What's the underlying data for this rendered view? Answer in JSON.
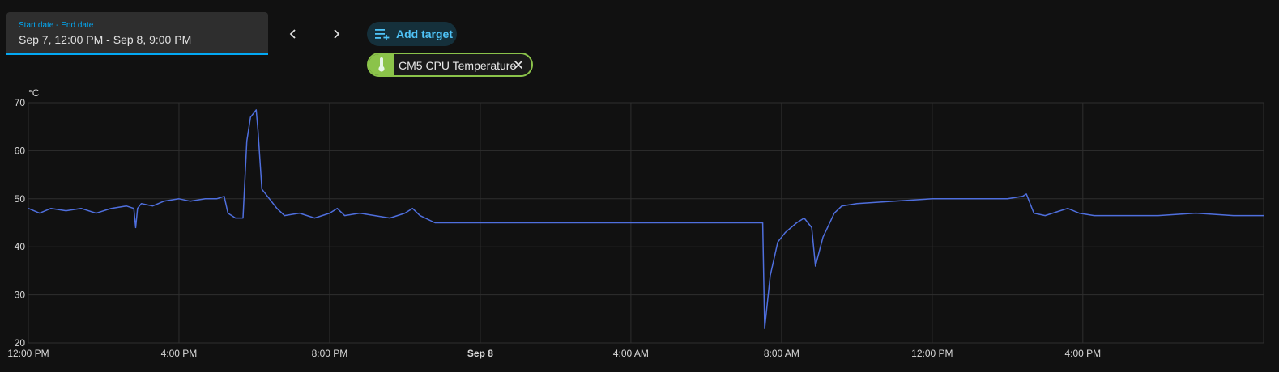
{
  "date_range": {
    "label": "Start date - End date",
    "value": "Sep 7, 12:00 PM - Sep 8, 9:00 PM"
  },
  "nav": {
    "prev_icon": "chevron-left-icon",
    "next_icon": "chevron-right-icon"
  },
  "add_target": {
    "label": "Add target",
    "icon": "playlist-plus-icon"
  },
  "targets": [
    {
      "label": "CM5 CPU Temperature",
      "icon": "thermometer-icon",
      "color": "#8bc34a"
    }
  ],
  "colors": {
    "accent": "#03a9f4",
    "series": "#4f6fde",
    "chip": "#8bc34a",
    "grid": "#2f2f2f",
    "background": "#111111"
  },
  "chart_data": {
    "type": "line",
    "ylabel": "°C",
    "xlabel": "",
    "ylim": [
      20,
      70
    ],
    "yticks": [
      20,
      30,
      40,
      50,
      60,
      70
    ],
    "grid": true,
    "xlim_hours": [
      0,
      32.8
    ],
    "xticks": [
      {
        "h": 0,
        "label": "12:00 PM",
        "bold": false
      },
      {
        "h": 4,
        "label": "4:00 PM",
        "bold": false
      },
      {
        "h": 8,
        "label": "8:00 PM",
        "bold": false
      },
      {
        "h": 12,
        "label": "Sep 8",
        "bold": true
      },
      {
        "h": 16,
        "label": "4:00 AM",
        "bold": false
      },
      {
        "h": 20,
        "label": "8:00 AM",
        "bold": false
      },
      {
        "h": 24,
        "label": "12:00 PM",
        "bold": false
      },
      {
        "h": 28,
        "label": "4:00 PM",
        "bold": false
      }
    ],
    "series": [
      {
        "name": "CM5 CPU Temperature",
        "points": [
          [
            0.0,
            48
          ],
          [
            0.3,
            47
          ],
          [
            0.6,
            48
          ],
          [
            1.0,
            47.5
          ],
          [
            1.4,
            48
          ],
          [
            1.8,
            47
          ],
          [
            2.2,
            48
          ],
          [
            2.6,
            48.5
          ],
          [
            2.8,
            48
          ],
          [
            2.85,
            44
          ],
          [
            2.9,
            48
          ],
          [
            3.0,
            49
          ],
          [
            3.3,
            48.5
          ],
          [
            3.6,
            49.5
          ],
          [
            4.0,
            50
          ],
          [
            4.3,
            49.5
          ],
          [
            4.7,
            50
          ],
          [
            5.0,
            50
          ],
          [
            5.2,
            50.5
          ],
          [
            5.3,
            47
          ],
          [
            5.5,
            46
          ],
          [
            5.7,
            46
          ],
          [
            5.8,
            62
          ],
          [
            5.9,
            67
          ],
          [
            6.0,
            68
          ],
          [
            6.05,
            68.5
          ],
          [
            6.1,
            64
          ],
          [
            6.2,
            52
          ],
          [
            6.4,
            50
          ],
          [
            6.6,
            48
          ],
          [
            6.8,
            46.5
          ],
          [
            7.2,
            47
          ],
          [
            7.6,
            46
          ],
          [
            8.0,
            47
          ],
          [
            8.2,
            48
          ],
          [
            8.4,
            46.5
          ],
          [
            8.8,
            47
          ],
          [
            9.2,
            46.5
          ],
          [
            9.6,
            46
          ],
          [
            10.0,
            47
          ],
          [
            10.2,
            48
          ],
          [
            10.4,
            46.5
          ],
          [
            10.8,
            45
          ],
          [
            15.0,
            45
          ],
          [
            18.0,
            45
          ],
          [
            19.5,
            45
          ],
          [
            19.55,
            23
          ],
          [
            19.7,
            34
          ],
          [
            19.9,
            41
          ],
          [
            20.1,
            43
          ],
          [
            20.4,
            45
          ],
          [
            20.6,
            46
          ],
          [
            20.8,
            44
          ],
          [
            20.9,
            36
          ],
          [
            21.1,
            42
          ],
          [
            21.4,
            47
          ],
          [
            21.6,
            48.5
          ],
          [
            22.0,
            49
          ],
          [
            23.0,
            49.5
          ],
          [
            24.0,
            50
          ],
          [
            25.0,
            50
          ],
          [
            26.0,
            50
          ],
          [
            26.4,
            50.5
          ],
          [
            26.5,
            51
          ],
          [
            26.7,
            47
          ],
          [
            27.0,
            46.5
          ],
          [
            27.4,
            47.5
          ],
          [
            27.6,
            48
          ],
          [
            27.9,
            47
          ],
          [
            28.3,
            46.5
          ],
          [
            29.0,
            46.5
          ],
          [
            30.0,
            46.5
          ],
          [
            31.0,
            47
          ],
          [
            32.0,
            46.5
          ],
          [
            32.8,
            46.5
          ]
        ]
      }
    ]
  }
}
